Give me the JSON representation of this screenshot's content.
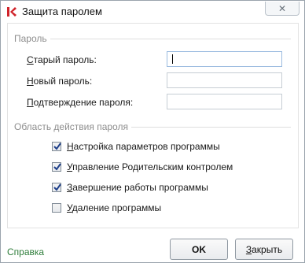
{
  "window": {
    "title": "Защита паролем",
    "close_glyph": "✕"
  },
  "password_section": {
    "heading": "Пароль",
    "fields": [
      {
        "label_key": "С",
        "label_rest": "тарый пароль:",
        "value": ""
      },
      {
        "label_key": "Н",
        "label_rest": "овый пароль:",
        "value": ""
      },
      {
        "label_key": "П",
        "label_rest": "одтверждение пароля:",
        "value": ""
      }
    ]
  },
  "scope_section": {
    "heading": "Область действия пароля",
    "options": [
      {
        "label_key": "Н",
        "label_rest": "астройка параметров программы",
        "checked": true
      },
      {
        "label_key": "У",
        "label_rest": "правление Родительским контролем",
        "checked": true
      },
      {
        "label_key": "З",
        "label_rest": "авершение работы программы",
        "checked": true
      },
      {
        "label_key": "У",
        "label_rest": "даление программы",
        "checked": false
      }
    ]
  },
  "footer": {
    "help_label": "Справка",
    "ok_label": "OK",
    "close_key": "З",
    "close_rest": "акрыть"
  },
  "colors": {
    "accent_red": "#d0232a",
    "help_link": "#2e7d3a",
    "section_heading": "#8e8e8e"
  },
  "icons": {
    "app": "kaspersky-logo-icon",
    "close": "close-icon",
    "check": "checkmark-icon"
  }
}
